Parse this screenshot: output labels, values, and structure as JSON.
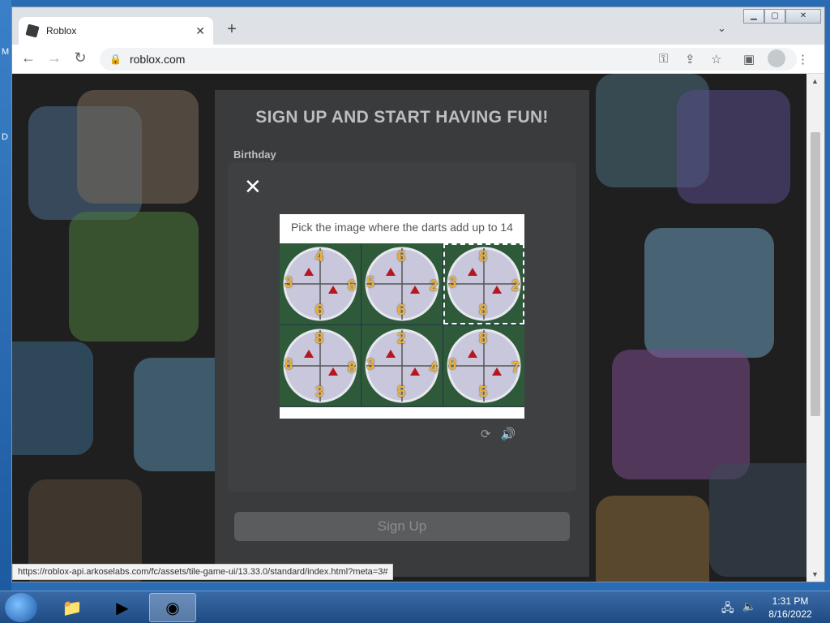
{
  "browser": {
    "tab_title": "Roblox",
    "new_tab": "+",
    "url": "roblox.com",
    "status_url": "https://roblox-api.arkoselabs.com/fc/assets/tile-game-ui/13.33.0/standard/index.html?meta=3#"
  },
  "page": {
    "headline": "SIGN UP AND START HAVING FUN!",
    "birthday_label": "Birthday",
    "signup_button": "Sign Up"
  },
  "captcha": {
    "prompt": "Pick the image where the darts add up to 14",
    "tiles": [
      {
        "numbers": [
          "4",
          "3",
          "6",
          "6"
        ],
        "selected": false
      },
      {
        "numbers": [
          "6",
          "5",
          "2",
          "6"
        ],
        "selected": false
      },
      {
        "numbers": [
          "8",
          "3",
          "2",
          "8"
        ],
        "selected": true
      },
      {
        "numbers": [
          "8",
          "8",
          "8",
          "3"
        ],
        "selected": false
      },
      {
        "numbers": [
          "2",
          "3",
          "4",
          "5"
        ],
        "selected": false
      },
      {
        "numbers": [
          "8",
          "8",
          "7",
          "5"
        ],
        "selected": false
      }
    ]
  },
  "taskbar": {
    "time": "1:31 PM",
    "date": "8/16/2022"
  },
  "desktop": {
    "left_letters": [
      "M",
      "D"
    ]
  }
}
